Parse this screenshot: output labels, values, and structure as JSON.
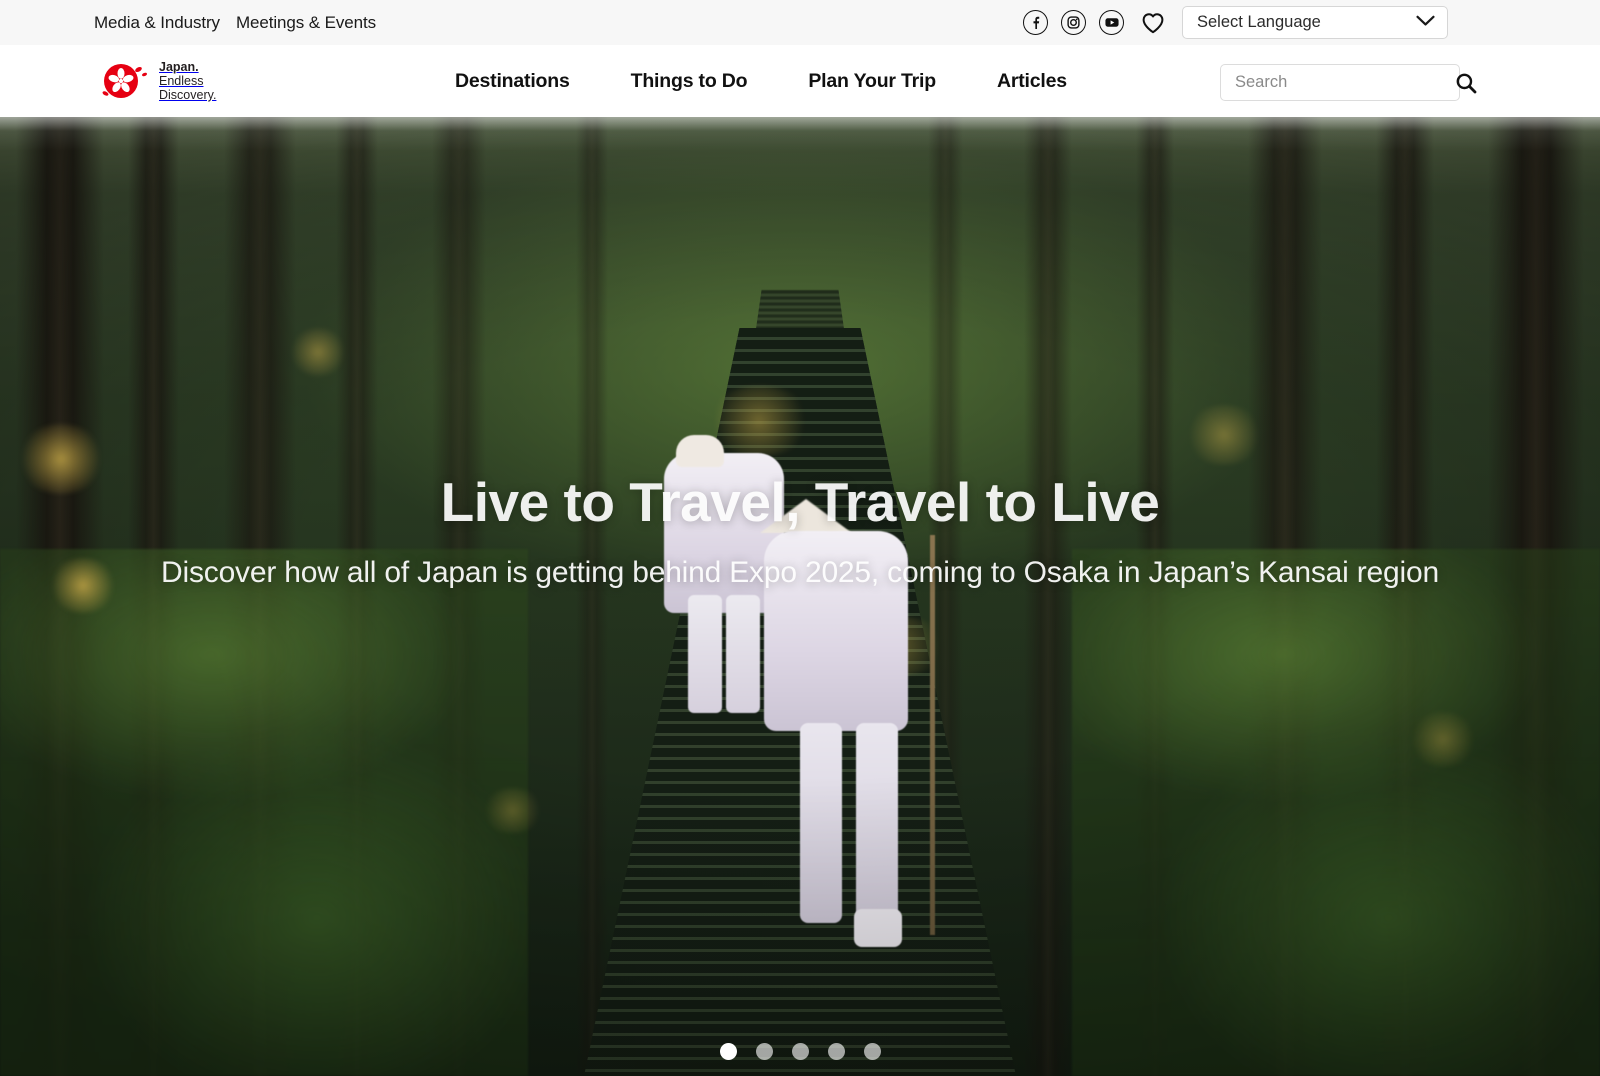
{
  "utility_bar": {
    "links": [
      {
        "label": "Media & Industry",
        "name": "media-industry"
      },
      {
        "label": "Meetings & Events",
        "name": "meetings-events"
      }
    ],
    "social": [
      {
        "name": "facebook-icon",
        "glyph": "f"
      },
      {
        "name": "instagram-icon",
        "glyph": "▢"
      },
      {
        "name": "youtube-icon",
        "glyph": "▶"
      }
    ],
    "favorites_icon": "heart-icon",
    "language": {
      "selected": "Select Language",
      "chevron_icon": "chevron-down-icon"
    }
  },
  "header": {
    "logo": {
      "mark": "cherry-blossom-icon",
      "line1": "Japan.",
      "line2": "Endless",
      "line3": "Discovery.",
      "brand_color": "#e60012"
    },
    "nav": [
      {
        "label": "Destinations",
        "name": "destinations"
      },
      {
        "label": "Things to Do",
        "name": "things-to-do"
      },
      {
        "label": "Plan Your Trip",
        "name": "plan-your-trip"
      },
      {
        "label": "Articles",
        "name": "articles"
      }
    ],
    "search": {
      "placeholder": "Search",
      "value": "",
      "icon": "search-icon"
    }
  },
  "hero": {
    "title": "Live to Travel, Travel to Live",
    "subtitle": "Discover how all of Japan is getting behind Expo 2025, coming to Osaka in Japan’s Kansai region",
    "carousel": {
      "total": 5,
      "active_index": 0
    }
  }
}
